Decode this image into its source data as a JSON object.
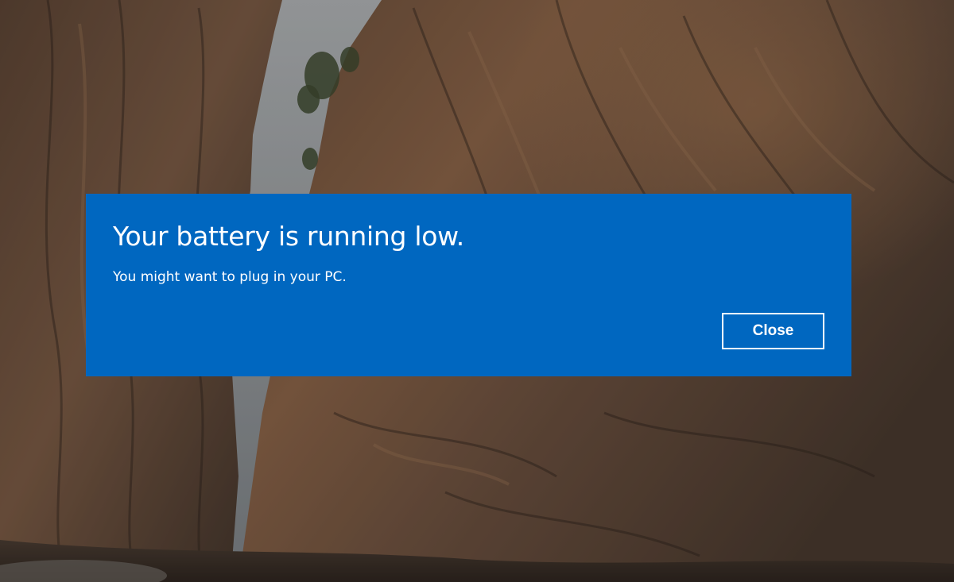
{
  "dialog": {
    "title": "Your battery is running low.",
    "message": "You might want to plug in your PC.",
    "close_label": "Close",
    "accent_color": "#0067c0"
  },
  "wallpaper": {
    "description_colors": {
      "sky": "#8d9296",
      "rock_dark": "#3a2f27",
      "rock_warm": "#8a6449"
    }
  }
}
